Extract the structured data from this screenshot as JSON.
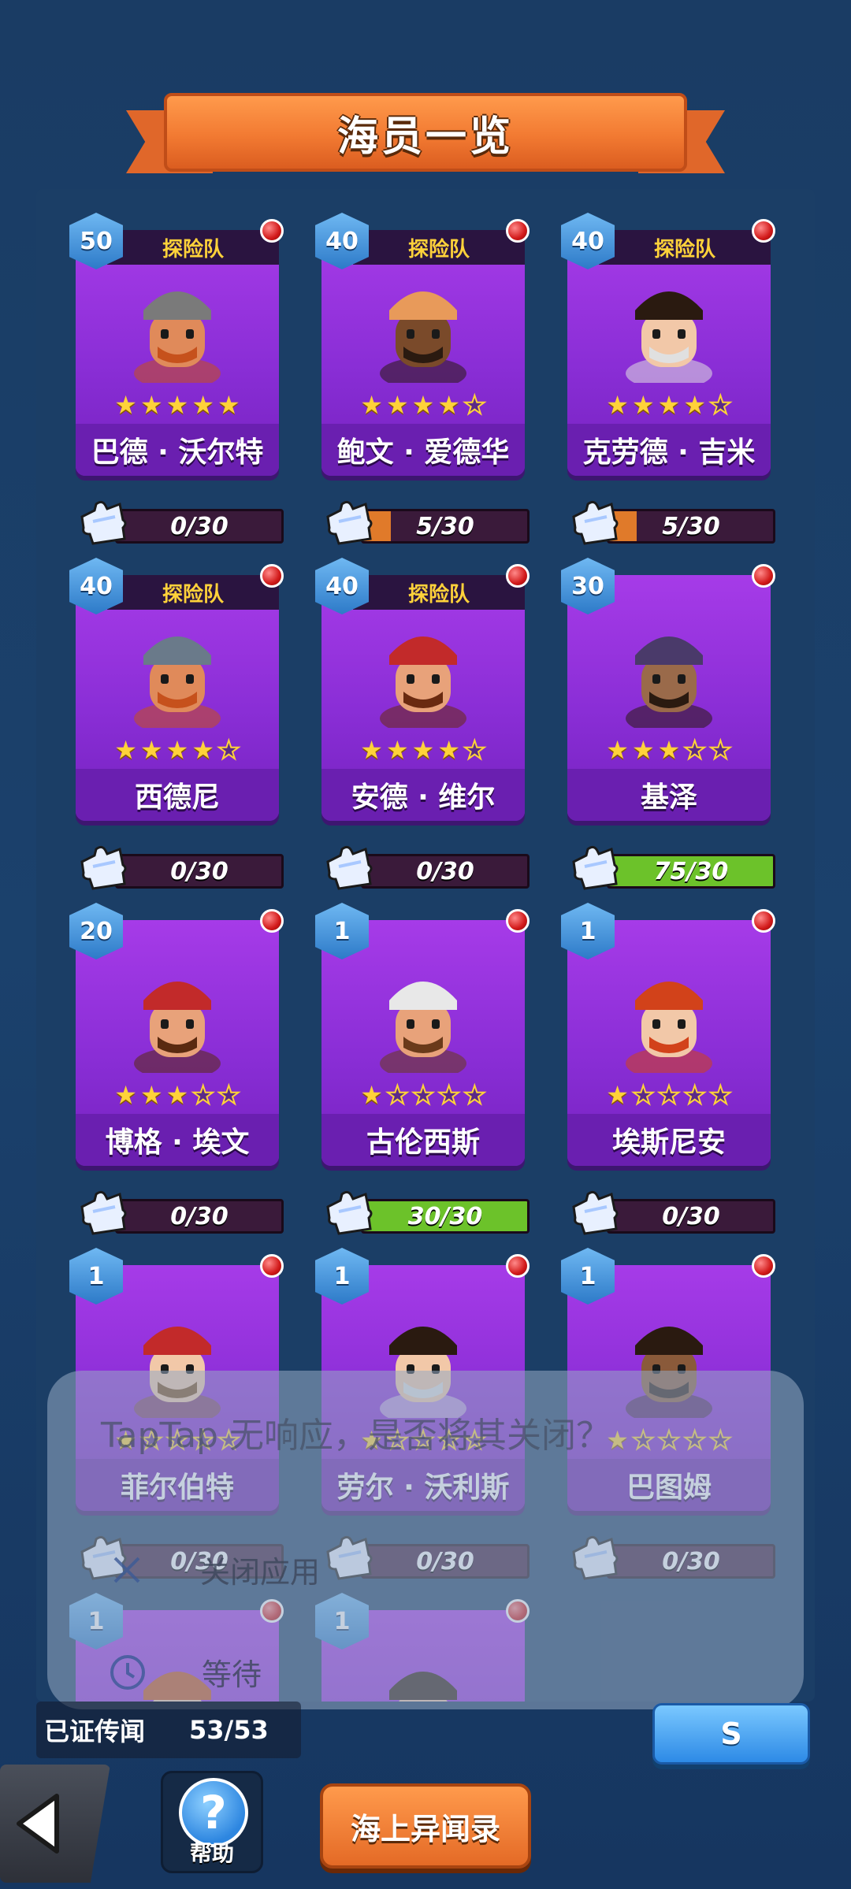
{
  "header": {
    "title": "海员一览"
  },
  "crew": [
    {
      "level": "50",
      "team": "探险队",
      "name": "巴德 · 沃尔特",
      "stars": 5,
      "progress_text": "0/30",
      "progress": 0,
      "bar_color": "#e07a2a",
      "skin": "#e08a5a",
      "hair": "#c6511c",
      "hat": "#7a7a7a"
    },
    {
      "level": "40",
      "team": "探险队",
      "name": "鲍文 · 爱德华",
      "stars": 4,
      "progress_text": "5/30",
      "progress": 0.1667,
      "bar_color": "#e07a2a",
      "skin": "#7a4a2a",
      "hair": "#2a1a10",
      "hat": "#e89a5a"
    },
    {
      "level": "40",
      "team": "探险队",
      "name": "克劳德 · 吉米",
      "stars": 4,
      "progress_text": "5/30",
      "progress": 0.1667,
      "bar_color": "#e07a2a",
      "skin": "#f2c8a8",
      "hair": "#e0e0e0",
      "hat": "#2a1a10"
    },
    {
      "level": "40",
      "team": "探险队",
      "name": "西德尼",
      "stars": 4,
      "progress_text": "0/30",
      "progress": 0,
      "bar_color": "#e07a2a",
      "skin": "#e08a5a",
      "hair": "#c6511c",
      "hat": "#6a7a8a"
    },
    {
      "level": "40",
      "team": "探险队",
      "name": "安德 · 维尔",
      "stars": 4,
      "progress_text": "0/30",
      "progress": 0,
      "bar_color": "#e07a2a",
      "skin": "#e8a27a",
      "hair": "#6a2a10",
      "hat": "#c22a2a"
    },
    {
      "level": "30",
      "team": "",
      "name": "基泽",
      "stars": 3,
      "progress_text": "75/30",
      "progress": 1,
      "bar_color": "#6cc22a",
      "skin": "#9a6a4a",
      "hair": "#2a1a10",
      "hat": "#4a3a6a"
    },
    {
      "level": "20",
      "team": "",
      "name": "博格 · 埃文",
      "stars": 3,
      "progress_text": "0/30",
      "progress": 0,
      "bar_color": "#e07a2a",
      "skin": "#e8a27a",
      "hair": "#5a2a10",
      "hat": "#c22a2a"
    },
    {
      "level": "1",
      "team": "",
      "name": "古伦西斯",
      "stars": 1,
      "progress_text": "30/30",
      "progress": 1,
      "bar_color": "#6cc22a",
      "skin": "#e8a27a",
      "hair": "#6a3a1a",
      "hat": "#e8e8e8"
    },
    {
      "level": "1",
      "team": "",
      "name": "埃斯尼安",
      "stars": 1,
      "progress_text": "0/30",
      "progress": 0,
      "bar_color": "#e07a2a",
      "skin": "#f2c8a8",
      "hair": "#d2421a",
      "hat": "#d2421a"
    },
    {
      "level": "1",
      "team": "",
      "name": "菲尔伯特",
      "stars": 1,
      "progress_text": "0/30",
      "progress": 0,
      "bar_color": "#e07a2a",
      "skin": "#f2c8a8",
      "hair": "#7a4a1a",
      "hat": "#c22a2a"
    },
    {
      "level": "1",
      "team": "",
      "name": "劳尔 · 沃利斯",
      "stars": 1,
      "progress_text": "0/30",
      "progress": 0,
      "bar_color": "#e07a2a",
      "skin": "#f2c8a8",
      "hair": "#e0e0e0",
      "hat": "#2a1a10"
    },
    {
      "level": "1",
      "team": "",
      "name": "巴图姆",
      "stars": 1,
      "progress_text": "0/30",
      "progress": 0,
      "bar_color": "#e07a2a",
      "skin": "#8a5a3a",
      "hair": "#2a1a10",
      "hat": "#2a1a10"
    },
    {
      "level": "1",
      "team": "",
      "name": "",
      "stars": 0,
      "progress_text": "",
      "progress": 0,
      "bar_color": "#e07a2a",
      "skin": "#f2c8a8",
      "hair": "#c6511c",
      "hat": "#c6511c"
    },
    {
      "level": "1",
      "team": "",
      "name": "",
      "stars": 0,
      "progress_text": "",
      "progress": 0,
      "bar_color": "#e07a2a",
      "skin": "#f2c8a8",
      "hair": "#2a1a10",
      "hat": "#2a1a10"
    }
  ],
  "dialog": {
    "message": "TapTap 无响应，是否将其关闭？",
    "close_label": "关闭应用",
    "wait_label": "等待",
    "close_icon": "close-icon",
    "wait_icon": "clock-icon"
  },
  "footer": {
    "collected_label": "已证传闻",
    "collected_value": "53/53",
    "s_label": "S",
    "help_label": "帮助",
    "help_icon": "question-icon",
    "back_icon": "back-arrow-icon",
    "log_label": "海上异闻录"
  },
  "colors": {
    "background": "#1b416c",
    "card": "#8a2ed6",
    "banner": "#f27a32",
    "level_badge": "#2d7ac8",
    "star": "#ffd23a"
  }
}
